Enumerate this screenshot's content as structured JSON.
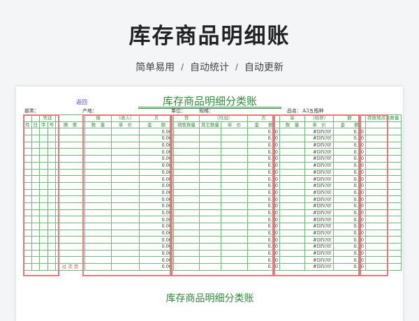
{
  "hero": {
    "title": "库存商品明细账",
    "features": [
      "简单易用",
      "自动统计",
      "自动更新"
    ],
    "separator": "/"
  },
  "sheet": {
    "back_link": "返回",
    "title": "库存商品明细分类账",
    "meta": {
      "department": "部类：",
      "origin": "产地：",
      "unit": "单位：",
      "spec": "规格：",
      "product_name_label": "品名：",
      "product_name": "A3五瓶种"
    },
    "headers": {
      "voucher": "凭证",
      "month": "月",
      "day": "日",
      "word": "字",
      "number": "号",
      "summary": "摘　要",
      "debit": "借",
      "debit_in": "（收入）",
      "debit_side": "方",
      "credit": "贷",
      "credit_out": "（付出）",
      "credit_side": "方",
      "balance": "余",
      "balance_carry": "（结存）",
      "balance_side": "额",
      "quantity": "数　量",
      "unit_price": "单　价",
      "amount": "金　　额",
      "sales_qty": "销售数量",
      "other_qty": "其它数量",
      "storage": "存放地点及数量"
    },
    "amount_value": "0.00",
    "div_error": "#DIV/0!",
    "carry_forward": "过 次 页",
    "footer_title": "库存商品明细分类账"
  },
  "colors": {
    "accent_green": "#2f8a3a",
    "border_red": "#e27b7b",
    "link_blue": "#3d3dd0"
  }
}
